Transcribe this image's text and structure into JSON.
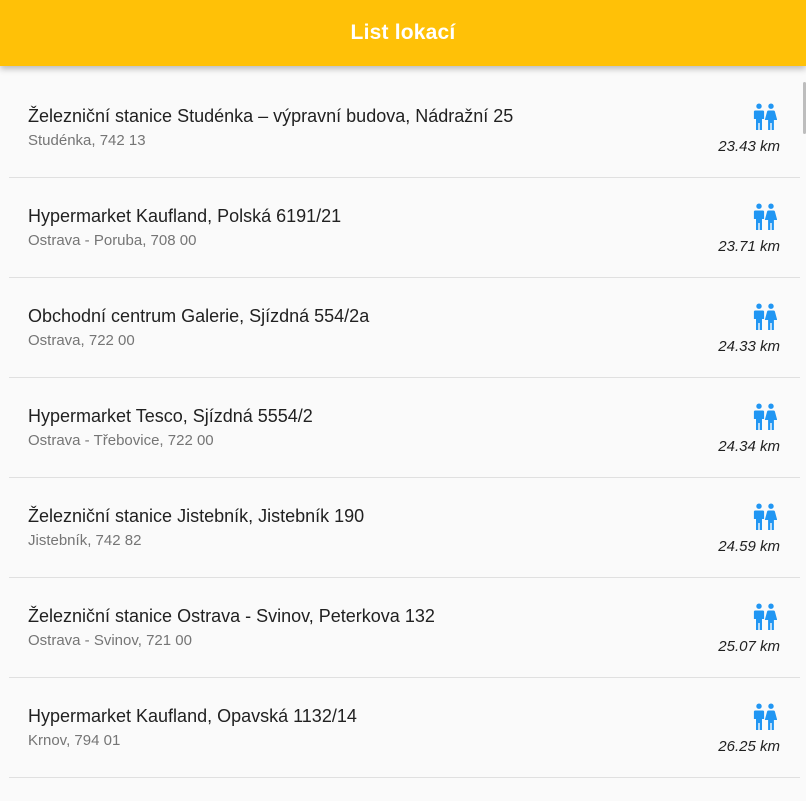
{
  "appbar": {
    "title": "List lokací",
    "color": "#ffc107"
  },
  "icon": {
    "name": "restroom-icon",
    "color": "#2196f3"
  },
  "locations": [
    {
      "title": "Železniční stanice Studénka – výpravní budova, Nádražní 25",
      "subtitle": "Studénka, 742 13",
      "distance": "23.43 km"
    },
    {
      "title": "Hypermarket Kaufland, Polská 6191/21",
      "subtitle": "Ostrava - Poruba, 708 00",
      "distance": "23.71 km"
    },
    {
      "title": "Obchodní centrum Galerie, Sjízdná 554/2a",
      "subtitle": "Ostrava, 722 00",
      "distance": "24.33 km"
    },
    {
      "title": "Hypermarket Tesco, Sjízdná 5554/2",
      "subtitle": "Ostrava - Třebovice, 722 00",
      "distance": "24.34 km"
    },
    {
      "title": "Železniční stanice Jistebník, Jistebník 190",
      "subtitle": "Jistebník, 742 82",
      "distance": "24.59 km"
    },
    {
      "title": "Železniční stanice Ostrava - Svinov, Peterkova 132",
      "subtitle": "Ostrava - Svinov, 721 00",
      "distance": "25.07 km"
    },
    {
      "title": "Hypermarket Kaufland, Opavská 1132/14",
      "subtitle": "Krnov, 794 01",
      "distance": "26.25 km"
    }
  ]
}
